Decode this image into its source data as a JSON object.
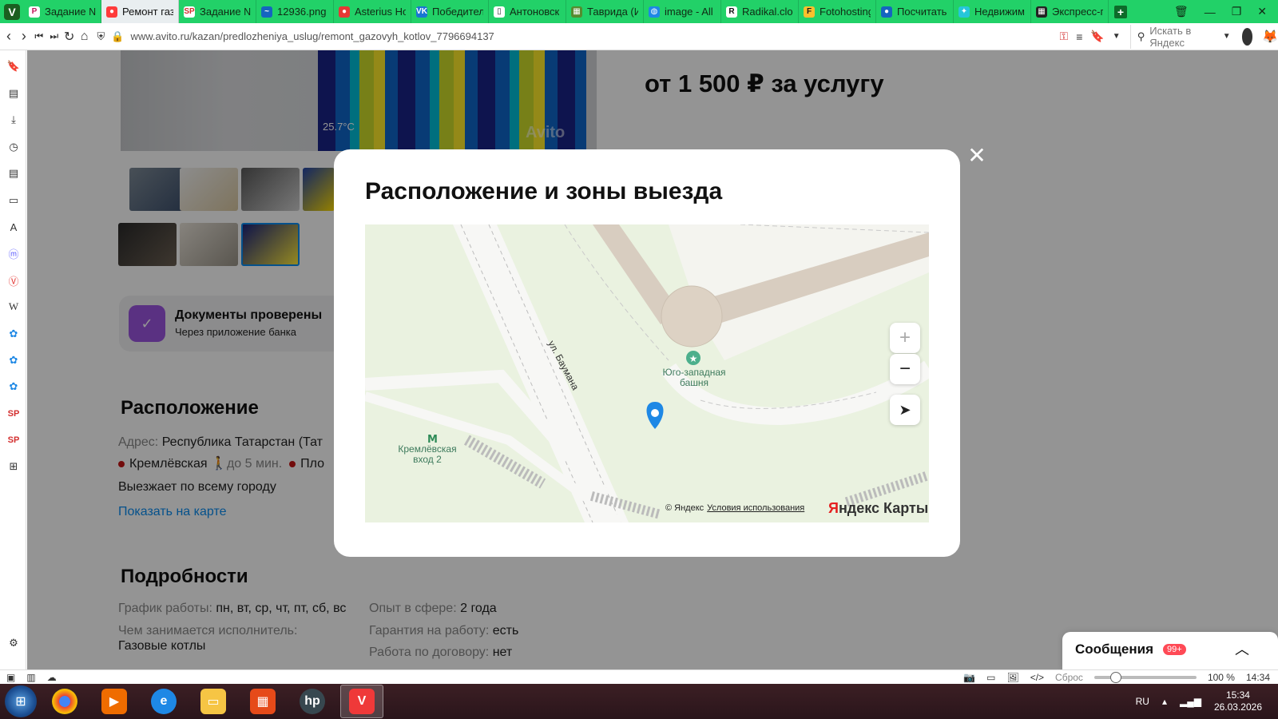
{
  "browser": {
    "tabs": [
      {
        "label": "Задание №",
        "icon_text": "P",
        "icon_color": "#ffffff",
        "icon_fg": "#c2185b"
      },
      {
        "label": "Ремонт газ",
        "icon_text": "●",
        "icon_color": "#ff3b3b",
        "icon_fg": "#ffffff",
        "active": true
      },
      {
        "label": "Задание №",
        "icon_text": "SP",
        "icon_color": "#ffffff",
        "icon_fg": "#d32f2f"
      },
      {
        "label": "12936.png",
        "icon_text": "~",
        "icon_color": "#1565c0",
        "icon_fg": "#ffffff"
      },
      {
        "label": "Asterius Ho",
        "icon_text": "●",
        "icon_color": "#e53935",
        "icon_fg": "#ffffff"
      },
      {
        "label": "Победител",
        "icon_text": "VK",
        "icon_color": "#1976d2",
        "icon_fg": "#ffffff"
      },
      {
        "label": "Антоновск",
        "icon_text": "▯",
        "icon_color": "#ffffff",
        "icon_fg": "#333333"
      },
      {
        "label": "Таврида (И",
        "icon_text": "▦",
        "icon_color": "#558b2f",
        "icon_fg": "#ffffff"
      },
      {
        "label": "image - All",
        "icon_text": "◍",
        "icon_color": "#1e88e5",
        "icon_fg": "#ffffff"
      },
      {
        "label": "Radikal.clou",
        "icon_text": "R",
        "icon_color": "#ffffff",
        "icon_fg": "#111111"
      },
      {
        "label": "Fotohosting",
        "icon_text": "F",
        "icon_color": "#fbc02d",
        "icon_fg": "#1a1a1a"
      },
      {
        "label": "Посчитать",
        "icon_text": "●",
        "icon_color": "#1565c0",
        "icon_fg": "#ffffff"
      },
      {
        "label": "Недвижим",
        "icon_text": "✦",
        "icon_color": "#26c6da",
        "icon_fg": "#ffffff"
      },
      {
        "label": "Экспресс-п",
        "icon_text": "▦",
        "icon_color": "#222222",
        "icon_fg": "#ffffff"
      }
    ],
    "url": "www.avito.ru/kazan/predlozheniya_uslug/remont_gazovyh_kotlov_7796694137",
    "search_placeholder": "Искать в Яндекс"
  },
  "page": {
    "price": "от 1 500 ₽ за услугу",
    "photo_temp": "25.7°C",
    "watermark": "Avito",
    "docs_title": "Документы проверены",
    "docs_subtitle": "Через приложение банка",
    "location_heading": "Расположение",
    "address_label": "Адрес:",
    "address_value": "Республика Татарстан (Тат",
    "metro1": "Кремлёвская",
    "metro1_time": "до 5 мин.",
    "metro2": "Пло",
    "travel": "Выезжает по всему городу",
    "show_map": "Показать на карте",
    "details_heading": "Подробности",
    "schedule_label": "График работы:",
    "schedule_value": "пн, вт, ср, чт, пт, сб, вс",
    "occupation_label": "Чем занимается исполнитель:",
    "occupation_value": "Газовые котлы",
    "experience_label": "Опыт в сфере:",
    "experience_value": "2 года",
    "warranty_label": "Гарантия на работу:",
    "warranty_value": "есть",
    "contract_label": "Работа по договору:",
    "contract_value": "нет",
    "messages_label": "Сообщения",
    "messages_badge": "99+"
  },
  "modal": {
    "title": "Расположение и зоны выезда",
    "map_labels": {
      "street": "ул. Баумана",
      "tower_line1": "Юго-западная",
      "tower_line2": "башня",
      "metro_line1": "Кремлёвская",
      "metro_line2": "вход 2"
    },
    "copyright": "© Яндекс",
    "terms": "Условия использования",
    "brand_y": "Я",
    "brand_rest": "ндекс Карты"
  },
  "statusbar": {
    "reset": "Сброс",
    "zoom": "100 %",
    "time": "14:34"
  },
  "taskbar": {
    "lang": "RU",
    "clock_time": "15:34",
    "clock_date": "26.03.2026"
  }
}
